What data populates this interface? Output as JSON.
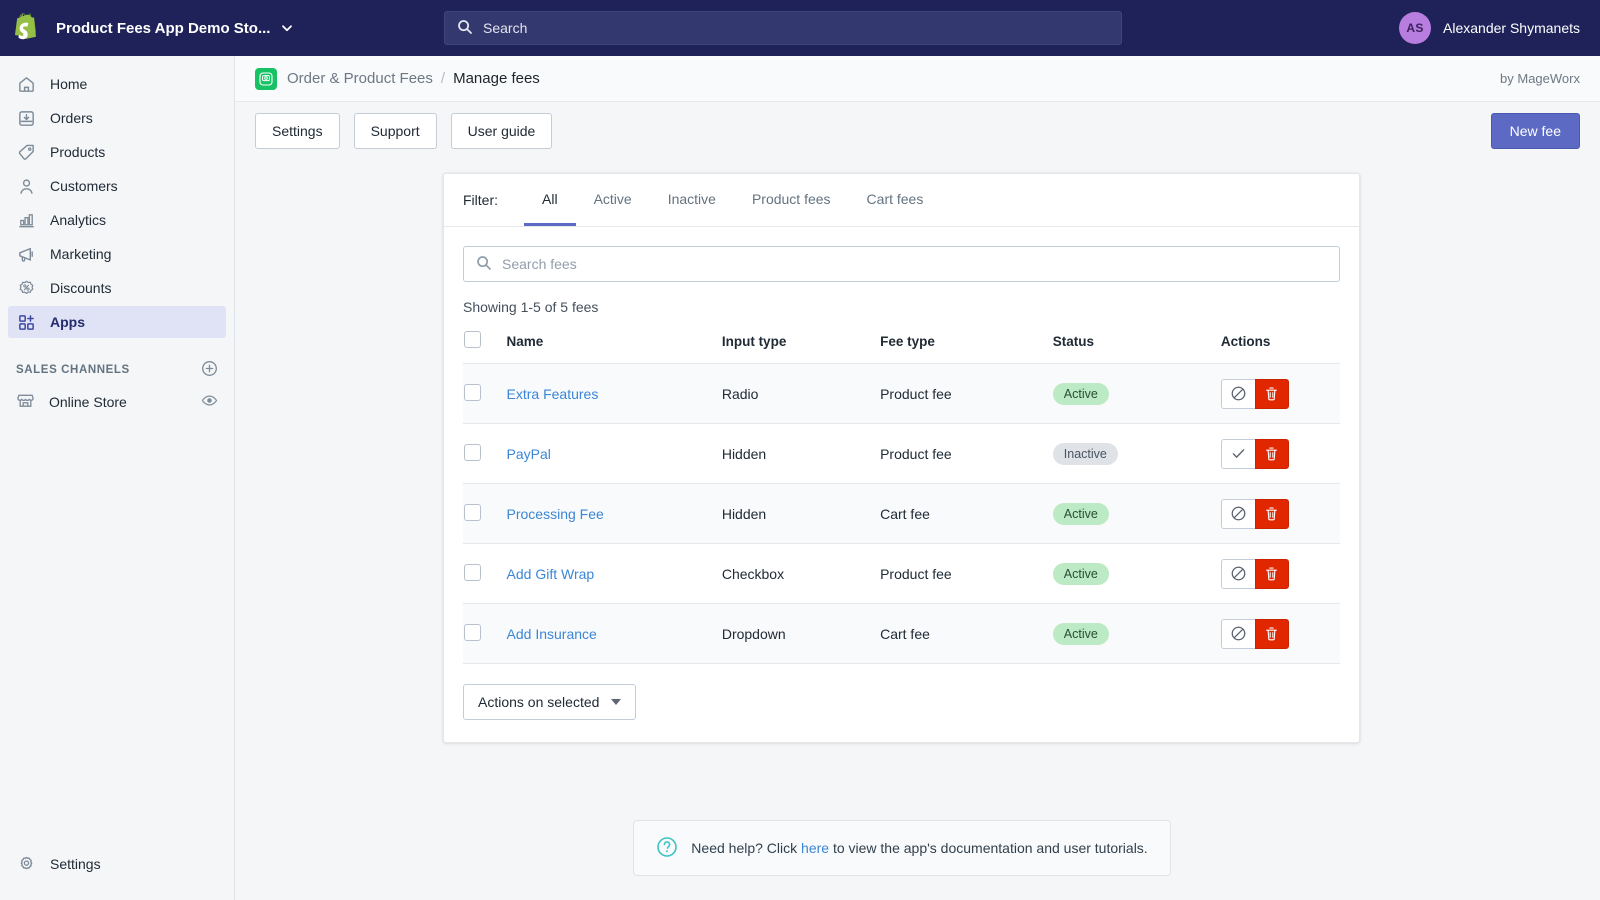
{
  "topbar": {
    "logo_icon": "shopify-bag-icon",
    "store_name": "Product Fees App Demo Sto...",
    "store_caret_icon": "chevron-down-icon",
    "search": {
      "icon": "search-icon",
      "placeholder": "Search",
      "value": ""
    },
    "user": {
      "initials": "AS",
      "name": "Alexander Shymanets"
    },
    "colors": {
      "background": "#1f2259",
      "search_field": "#33386e",
      "avatar": "#b77ee0"
    }
  },
  "sidebar": {
    "items": [
      {
        "label": "Home",
        "icon": "home-icon",
        "active": false
      },
      {
        "label": "Orders",
        "icon": "orders-inbox-icon",
        "active": false
      },
      {
        "label": "Products",
        "icon": "product-tag-icon",
        "active": false
      },
      {
        "label": "Customers",
        "icon": "customer-person-icon",
        "active": false
      },
      {
        "label": "Analytics",
        "icon": "analytics-bar-chart-icon",
        "active": false
      },
      {
        "label": "Marketing",
        "icon": "marketing-megaphone-icon",
        "active": false
      },
      {
        "label": "Discounts",
        "icon": "discount-percent-icon",
        "active": false
      },
      {
        "label": "Apps",
        "icon": "apps-grid-plus-icon",
        "active": true
      }
    ],
    "section_title": "SALES CHANNELS",
    "section_add_icon": "plus-circle-icon",
    "channels": [
      {
        "label": "Online Store",
        "icon": "storefront-icon",
        "action_icon": "eye-icon"
      }
    ],
    "footer": {
      "label": "Settings",
      "icon": "gear-icon"
    },
    "colors": {
      "background": "#f4f6f8",
      "active_item": "#dfe3f5",
      "active_text": "#252c6e"
    }
  },
  "breadcrumb": {
    "app_icon": "order-product-fees-app-icon",
    "app_name": "Order & Product Fees",
    "separator": "/",
    "current": "Manage fees",
    "byline": "by MageWorx"
  },
  "toolbar": {
    "settings_label": "Settings",
    "support_label": "Support",
    "user_guide_label": "User guide",
    "new_fee_label": "New fee",
    "primary_color": "#5c6ac4"
  },
  "filters": {
    "label": "Filter:",
    "tabs": [
      {
        "label": "All",
        "active": true
      },
      {
        "label": "Active",
        "active": false
      },
      {
        "label": "Inactive",
        "active": false
      },
      {
        "label": "Product fees",
        "active": false
      },
      {
        "label": "Cart fees",
        "active": false
      }
    ]
  },
  "search_fees": {
    "icon": "search-icon",
    "placeholder": "Search fees",
    "value": ""
  },
  "results_summary": "Showing 1-5 of 5 fees",
  "table": {
    "select_all_checkbox": false,
    "columns": [
      "Name",
      "Input type",
      "Fee type",
      "Status",
      "Actions"
    ],
    "rows": [
      {
        "selected": false,
        "name": "Extra Features",
        "input_type": "Radio",
        "fee_type": "Product fee",
        "status": "Active",
        "toggle_icon": "disable-slash-circle-icon",
        "delete_icon": "trash-icon"
      },
      {
        "selected": false,
        "name": "PayPal",
        "input_type": "Hidden",
        "fee_type": "Product fee",
        "status": "Inactive",
        "toggle_icon": "enable-check-icon",
        "delete_icon": "trash-icon"
      },
      {
        "selected": false,
        "name": "Processing Fee",
        "input_type": "Hidden",
        "fee_type": "Cart fee",
        "status": "Active",
        "toggle_icon": "disable-slash-circle-icon",
        "delete_icon": "trash-icon"
      },
      {
        "selected": false,
        "name": "Add Gift Wrap",
        "input_type": "Checkbox",
        "fee_type": "Product fee",
        "status": "Active",
        "toggle_icon": "disable-slash-circle-icon",
        "delete_icon": "trash-icon"
      },
      {
        "selected": false,
        "name": "Add Insurance",
        "input_type": "Dropdown",
        "fee_type": "Cart fee",
        "status": "Active",
        "toggle_icon": "disable-slash-circle-icon",
        "delete_icon": "trash-icon"
      }
    ],
    "status_colors": {
      "active_bg": "#bbeac5",
      "active_text": "#2b4d34",
      "inactive_bg": "#dfe3e8",
      "inactive_text": "#49545f"
    },
    "delete_color": "#e02700"
  },
  "bulk_actions": {
    "label": "Actions on selected",
    "caret_icon": "caret-down-icon"
  },
  "help": {
    "icon": "question-circle-icon",
    "text_before": "Need help? Click ",
    "link": "here",
    "text_after": " to view the app's documentation and user tutorials.",
    "link_color": "#3b86d6"
  }
}
